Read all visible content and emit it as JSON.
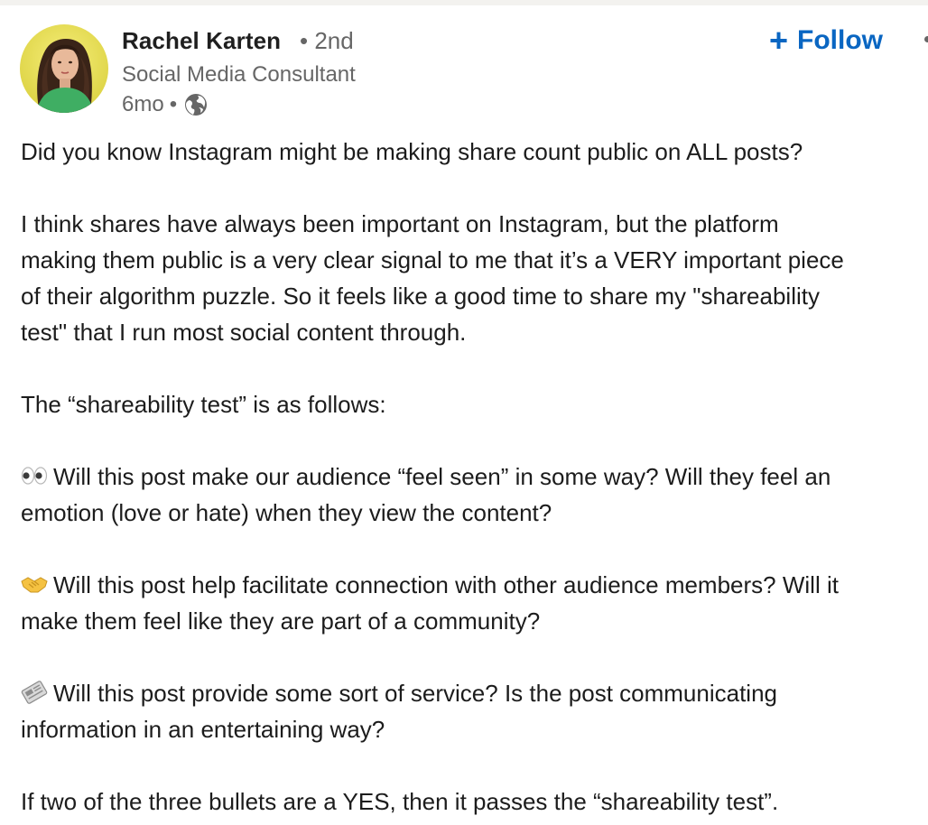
{
  "author": {
    "name": "Rachel Karten",
    "degree": "2nd",
    "headline": "Social Media Consultant",
    "time": "6mo",
    "visibility_icon": "globe-icon"
  },
  "actions": {
    "follow_label": "Follow",
    "follow_icon": "plus-icon",
    "accent_color": "#0a66c2"
  },
  "post": {
    "line1": "Did you know Instagram might be making share count public on ALL posts?",
    "p2_l1": "I think shares have always been important on Instagram, but the platform",
    "p2_l2": "making them public is a very clear signal to me that it’s a VERY important piece",
    "p2_l3": "of their algorithm puzzle. So it feels like a good time to share my \"shareability",
    "p2_l4": "test\" that I run most social content through.",
    "p3": "The “shareability test” is as follows:",
    "b1_icon": "eyes-emoji",
    "b1_l1": "Will this post make our audience “feel seen” in some way? Will they feel an",
    "b1_l2": "emotion (love or hate) when they view the content?",
    "b2_icon": "handshake-emoji",
    "b2_l1": "Will this post help facilitate connection with other audience members? Will it",
    "b2_l2": "make them feel like they are part of a community?",
    "b3_icon": "newspaper-emoji",
    "b3_l1": "Will this post provide some sort of service? Is the post communicating",
    "b3_l2": "information in an entertaining way?",
    "closing": "If two of the three bullets are a YES, then it passes the “shareability test”."
  }
}
